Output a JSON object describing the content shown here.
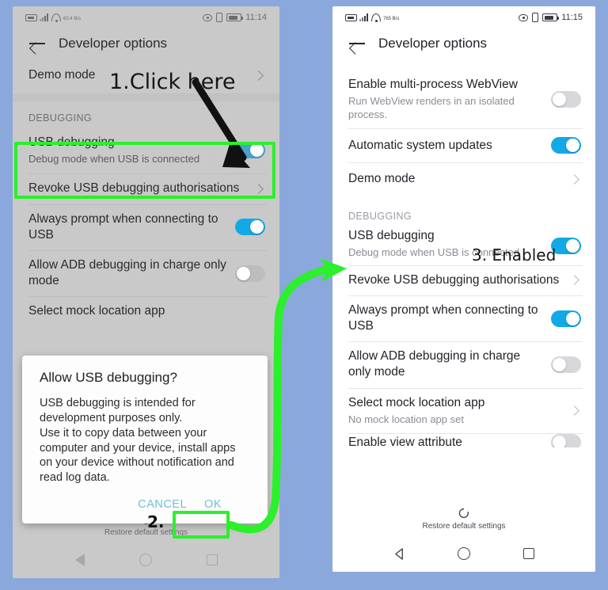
{
  "background_color": "#8ba8dc",
  "accent_toggle_on": "#13a9e6",
  "highlight_green": "#2bf02b",
  "dialog_button_color": "#6fbfd8",
  "left_phone": {
    "status_bar": {
      "time": "11:14",
      "network_rate": "63.4\nB/s"
    },
    "app_bar": {
      "title": "Developer options",
      "back_icon": "back-arrow-icon"
    },
    "rows": [
      {
        "title": "Demo mode",
        "sub": "",
        "control": "chevron"
      }
    ],
    "section_debugging": "DEBUGGING",
    "debug_rows": [
      {
        "title": "USB debugging",
        "sub": "Debug mode when USB is connected",
        "control": "toggle-on"
      },
      {
        "title": "Revoke USB debugging authorisations",
        "sub": "",
        "control": "chevron"
      },
      {
        "title": "Always prompt when connecting to USB",
        "sub": "",
        "control": "toggle-on"
      },
      {
        "title": "Allow ADB debugging in charge only mode",
        "sub": "",
        "control": "toggle-off"
      },
      {
        "title": "Select mock location app",
        "sub": "",
        "control": "chevron"
      }
    ],
    "restore_label": "Restore default settings",
    "nav": {
      "back": "nav-back-icon",
      "home": "nav-home-icon",
      "recents": "nav-recents-icon"
    }
  },
  "dialog": {
    "title": "Allow USB debugging?",
    "body": "USB debugging is intended for development purposes only.\nUse it to copy data between your computer and your device, install apps on your device without notification and read log data.",
    "cancel_label": "CANCEL",
    "ok_label": "OK"
  },
  "right_phone": {
    "status_bar": {
      "time": "11:15",
      "network_rate": "765\nB/s"
    },
    "app_bar": {
      "title": "Developer options",
      "back_icon": "back-arrow-icon"
    },
    "rows": [
      {
        "title": "Enable multi-process WebView",
        "sub": "Run WebView renders in an isolated process.",
        "control": "toggle-off"
      },
      {
        "title": "Automatic system updates",
        "sub": "",
        "control": "toggle-on"
      },
      {
        "title": "Demo mode",
        "sub": "",
        "control": "chevron"
      }
    ],
    "section_debugging": "DEBUGGING",
    "debug_rows": [
      {
        "title": "USB debugging",
        "sub": "Debug mode when USB is connected",
        "control": "toggle-on"
      },
      {
        "title": "Revoke USB debugging authorisations",
        "sub": "",
        "control": "chevron"
      },
      {
        "title": "Always prompt when connecting to USB",
        "sub": "",
        "control": "toggle-on"
      },
      {
        "title": "Allow ADB debugging in charge only mode",
        "sub": "",
        "control": "toggle-off"
      },
      {
        "title": "Select mock location app",
        "sub": "No mock location app set",
        "control": "chevron"
      },
      {
        "title": "Enable view attribute",
        "sub": "",
        "control": "toggle-off"
      }
    ],
    "restore_label": "Restore default settings",
    "nav": {
      "back": "nav-back-icon",
      "home": "nav-home-icon",
      "recents": "nav-recents-icon"
    }
  },
  "annotations": {
    "step1": "1.Click here",
    "step2": "2.",
    "step3": "3. Enabled"
  }
}
